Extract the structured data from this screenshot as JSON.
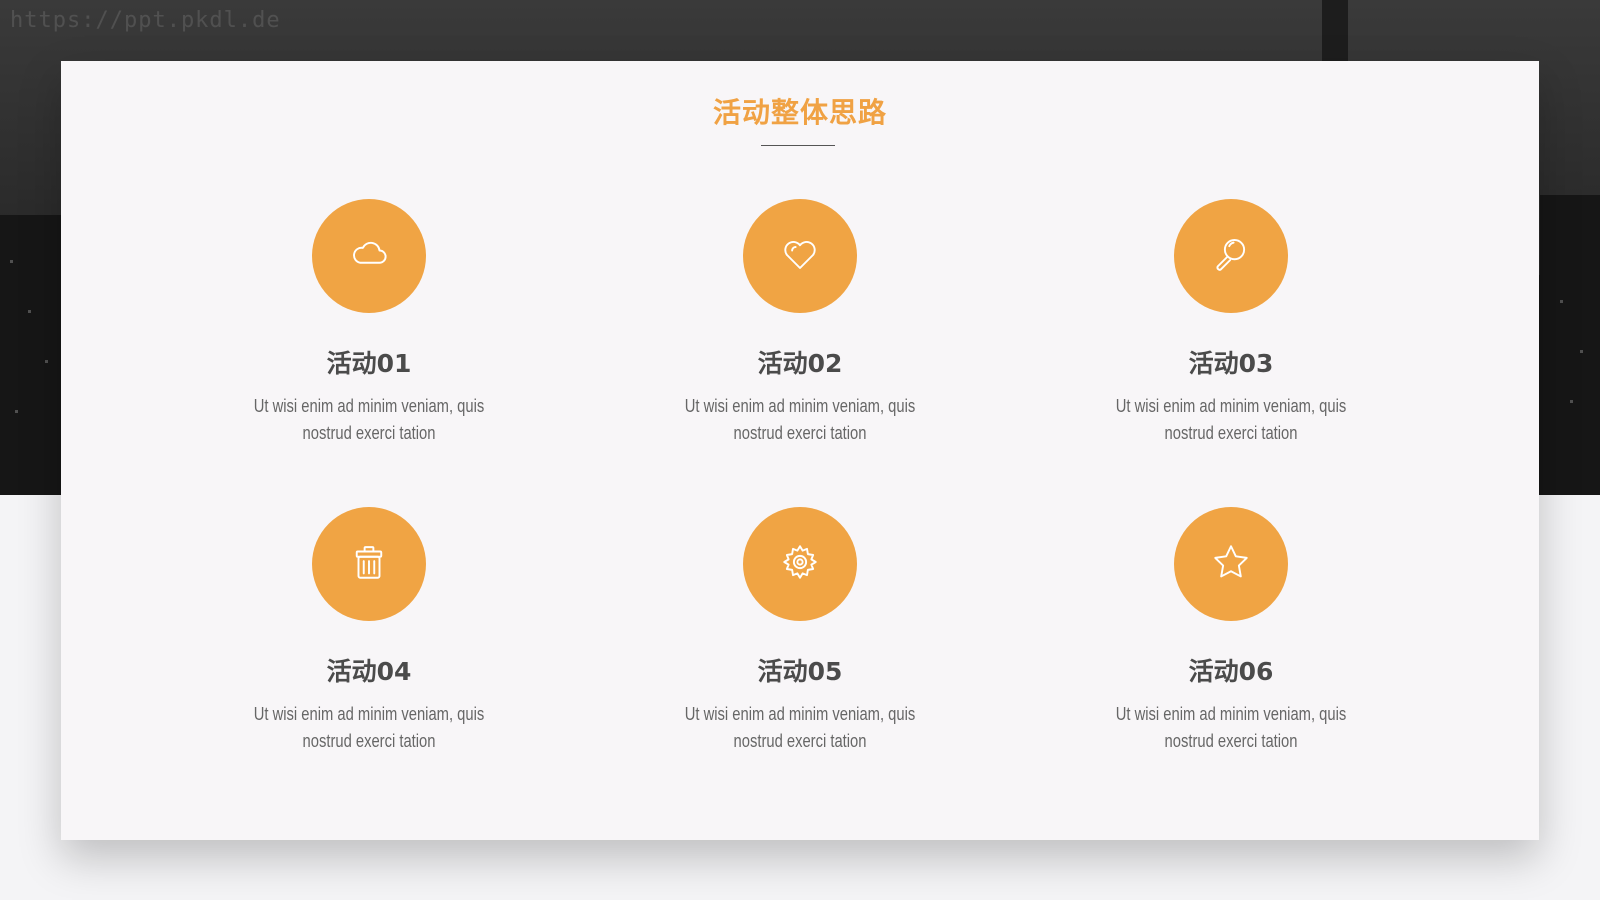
{
  "watermark": "https://ppt.pkdl.de",
  "colors": {
    "accent": "#f0a444",
    "title": "#f0a244",
    "text_dark": "#4b4b4b",
    "text_body": "#666666",
    "card": "#f8f6f8"
  },
  "header": {
    "title": "活动整体思路"
  },
  "items": [
    {
      "icon": "cloud-icon",
      "title": "活动01",
      "description": "Ut wisi enim ad minim veniam, quis nostrud exerci tation"
    },
    {
      "icon": "heart-icon",
      "title": "活动02",
      "description": "Ut wisi enim ad minim veniam, quis nostrud exerci tation"
    },
    {
      "icon": "search-icon",
      "title": "活动03",
      "description": "Ut wisi enim ad minim veniam, quis nostrud exerci tation"
    },
    {
      "icon": "trash-icon",
      "title": "活动04",
      "description": "Ut wisi enim ad minim veniam, quis nostrud exerci tation"
    },
    {
      "icon": "gear-icon",
      "title": "活动05",
      "description": "Ut wisi enim ad minim veniam, quis nostrud exerci tation"
    },
    {
      "icon": "star-icon",
      "title": "活动06",
      "description": "Ut wisi enim ad minim veniam, quis nostrud exerci tation"
    }
  ]
}
